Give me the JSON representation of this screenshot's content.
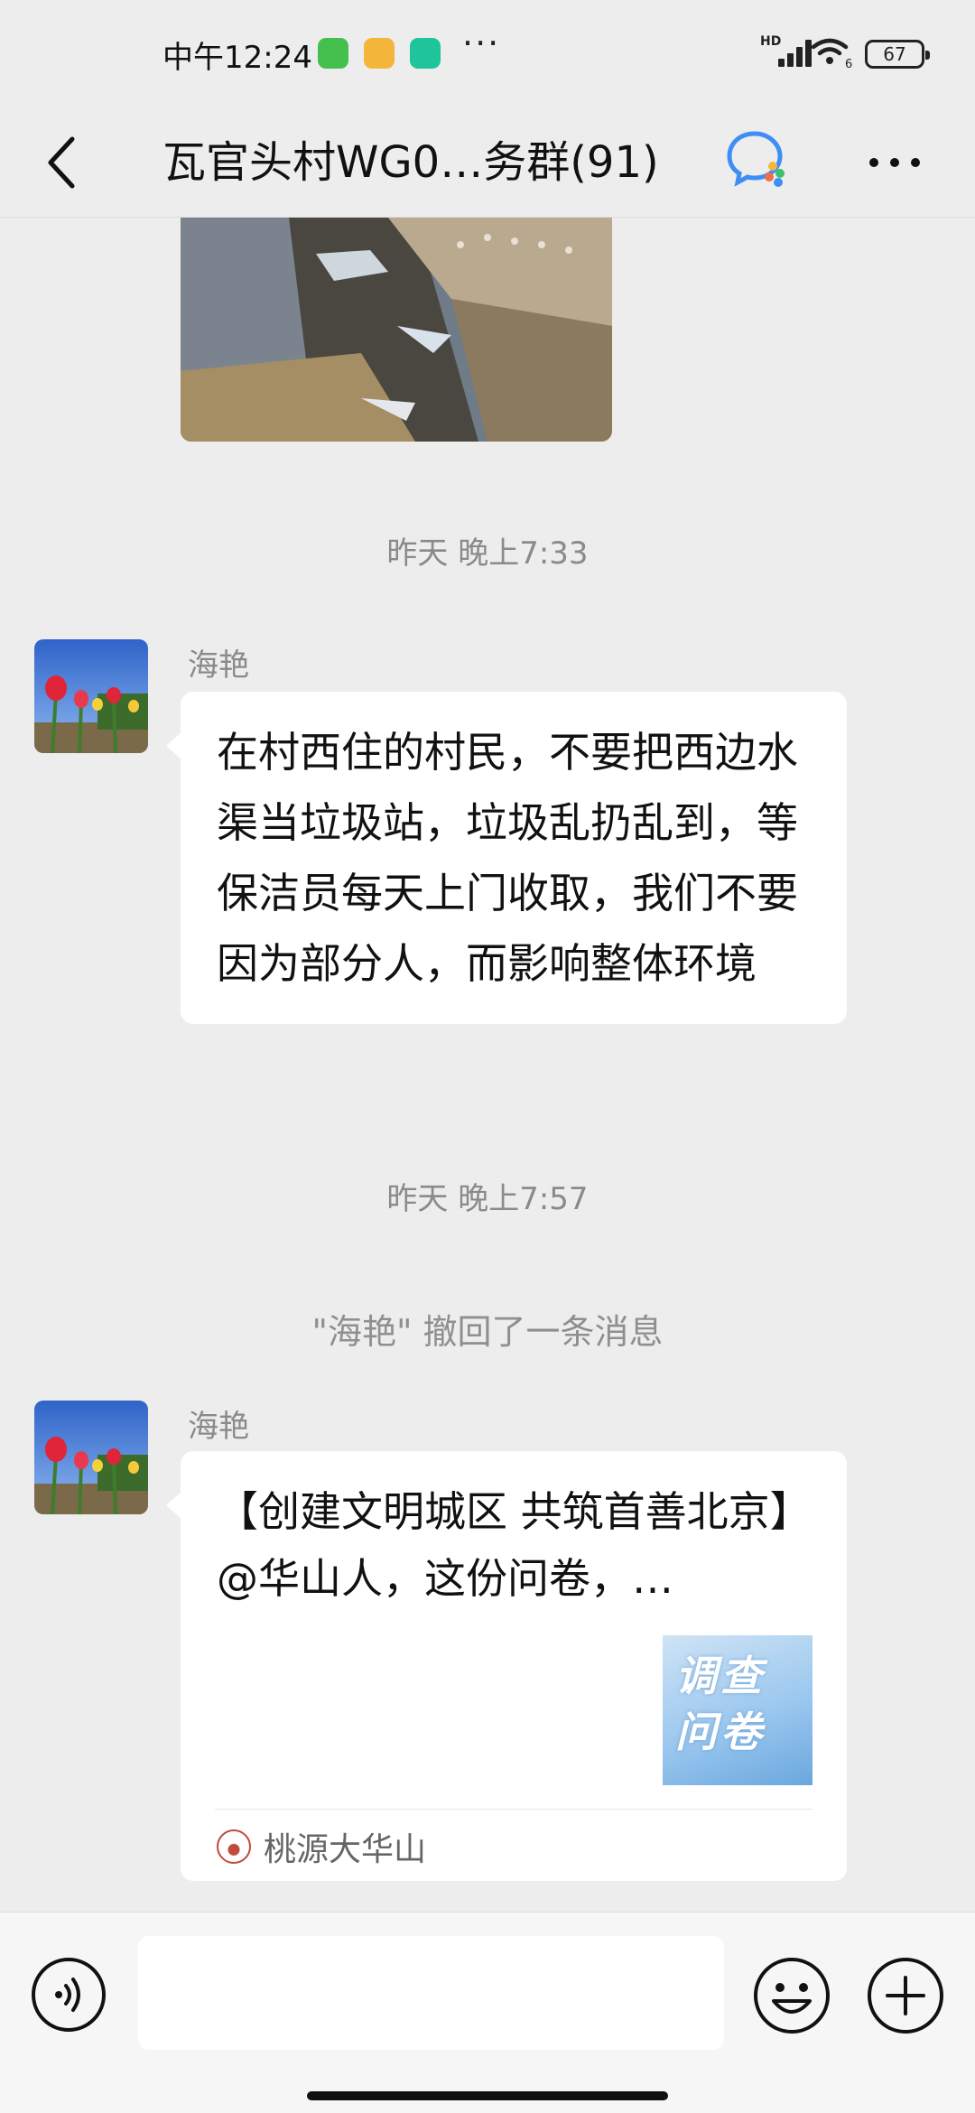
{
  "status_bar": {
    "time": "中午12:24",
    "more": "···",
    "network_label": "HD",
    "wifi_badge": "6",
    "battery": "67"
  },
  "header": {
    "title": "瓦官头村WG0…务群(91)"
  },
  "messages": [
    {
      "type": "timestamp",
      "text": "昨天 晚上7:33"
    },
    {
      "type": "text",
      "sender": "海艳",
      "text": "在村西住的村民，不要把西边水渠当垃圾站，垃圾乱扔乱到，等保洁员每天上门收取，我们不要因为部分人，而影响整体环境"
    },
    {
      "type": "timestamp",
      "text": "昨天 晚上7:57"
    },
    {
      "type": "system",
      "text": "\"海艳\" 撤回了一条消息"
    },
    {
      "type": "card",
      "sender": "海艳",
      "text": "【创建文明城区 共筑首善北京】@华山人，这份问卷，…",
      "thumb_text": "调查问卷",
      "source": "桃源大华山"
    }
  ],
  "colors": {
    "background": "#ededed",
    "bubble": "#ffffff",
    "meta_text": "#8a8a8a"
  }
}
